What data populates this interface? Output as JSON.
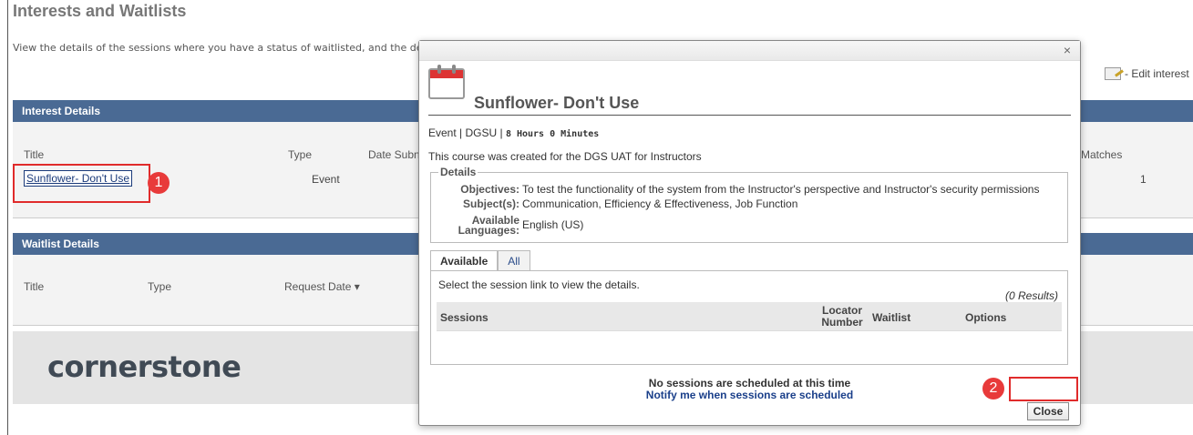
{
  "page": {
    "title": "Interests and Waitlists",
    "description": "View the details of the sessions where you have a status of waitlisted, and the details of the",
    "edit_interest": "- Edit interest"
  },
  "interest_panel": {
    "header": "Interest Details",
    "columns": {
      "title": "Title",
      "type": "Type",
      "date": "Date Subn",
      "matches": "Matches"
    },
    "row": {
      "title": "Sunflower- Don't Use",
      "type": "Event",
      "matches": "1"
    }
  },
  "waitlist_panel": {
    "header": "Waitlist Details",
    "columns": {
      "title": "Title",
      "type": "Type",
      "request_date": "Request Date"
    }
  },
  "logo": "cornerstone",
  "annotations": {
    "badge1": "1",
    "badge2": "2"
  },
  "modal": {
    "title": "Sunflower- Don't Use",
    "meta_type": "Event | DGSU |",
    "meta_duration": "8 Hours 0 Minutes",
    "description": "This course was created for the DGS UAT for Instructors",
    "details_legend": "Details",
    "objectives_label": "Objectives:",
    "objectives_value": "To test the functionality of the system from the Instructor's perspective and Instructor's security permissions",
    "subjects_label": "Subject(s):",
    "subjects_value": "Communication, Efficiency & Effectiveness, Job Function",
    "languages_label_1": "Available",
    "languages_label_2": "Languages:",
    "languages_value": "English (US)",
    "tabs": [
      "Available",
      "All"
    ],
    "tab_help": "Select the session link to view the details.",
    "results": "(0 Results)",
    "grid_columns": {
      "sessions": "Sessions",
      "locator_1": "Locator",
      "locator_2": "Number",
      "waitlist": "Waitlist",
      "options": "Options"
    },
    "no_sessions": "No sessions are scheduled at this time",
    "notify": "Notify me when sessions are scheduled",
    "close_label": "Close",
    "close_x": "×"
  },
  "colors": {
    "header_blue": "#4a6a94",
    "annotation_red": "#e02b2b"
  }
}
